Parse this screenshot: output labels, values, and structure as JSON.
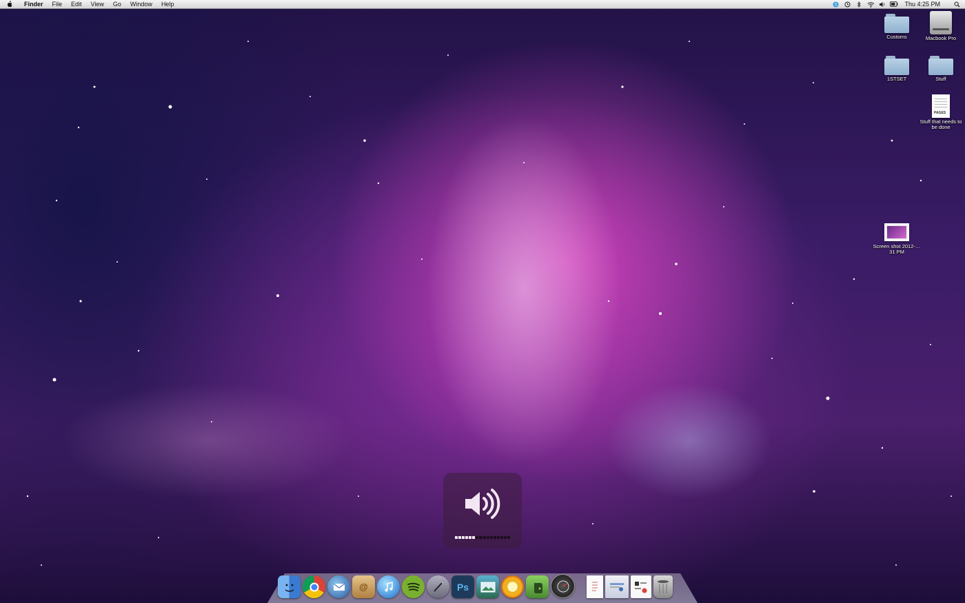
{
  "menubar": {
    "app_name": "Finder",
    "menus": [
      "File",
      "Edit",
      "View",
      "Go",
      "Window",
      "Help"
    ],
    "clock": "Thu 4:25 PM",
    "status_icons": [
      "skype-icon",
      "time-machine-icon",
      "bluetooth-icon",
      "wifi-icon",
      "volume-icon",
      "battery-icon",
      "spotlight-icon"
    ]
  },
  "desktop": {
    "icons": [
      {
        "label": "Customs",
        "type": "folder"
      },
      {
        "label": "Macbook Pro",
        "type": "drive"
      },
      {
        "label": "1STSET",
        "type": "folder"
      },
      {
        "label": "Stuff",
        "type": "folder"
      },
      {
        "label": "Stuff that needs to be done",
        "type": "document",
        "badge": "PAGES"
      },
      {
        "label": "Screen shot 2012-…31 PM",
        "type": "screenshot"
      }
    ]
  },
  "volume_hud": {
    "level_segments": 6,
    "total_segments": 16
  },
  "dock": {
    "apps": [
      {
        "name": "finder-icon",
        "color": "#4a8ee0"
      },
      {
        "name": "chrome-icon",
        "color": "#e04030"
      },
      {
        "name": "thunderbird-icon",
        "color": "#3a6db5"
      },
      {
        "name": "address-book-icon",
        "color": "#c9a060"
      },
      {
        "name": "itunes-icon",
        "color": "#2a8ad8"
      },
      {
        "name": "spotify-icon",
        "color": "#7ab030"
      },
      {
        "name": "script-editor-icon",
        "color": "#8a8a9a"
      },
      {
        "name": "photoshop-icon",
        "color": "#1e6fb5"
      },
      {
        "name": "preview-icon",
        "color": "#3a8a6a"
      },
      {
        "name": "sun-app-icon",
        "color": "#f0a820"
      },
      {
        "name": "evernote-icon",
        "color": "#5a9a40"
      },
      {
        "name": "dashboard-icon",
        "color": "#2a2a2a"
      }
    ],
    "stacks": [
      {
        "name": "document-stack-icon"
      },
      {
        "name": "downloads-stack-icon"
      },
      {
        "name": "documents-stack-icon"
      },
      {
        "name": "trash-icon"
      }
    ],
    "photoshop_label": "Ps",
    "address_label": "@"
  }
}
